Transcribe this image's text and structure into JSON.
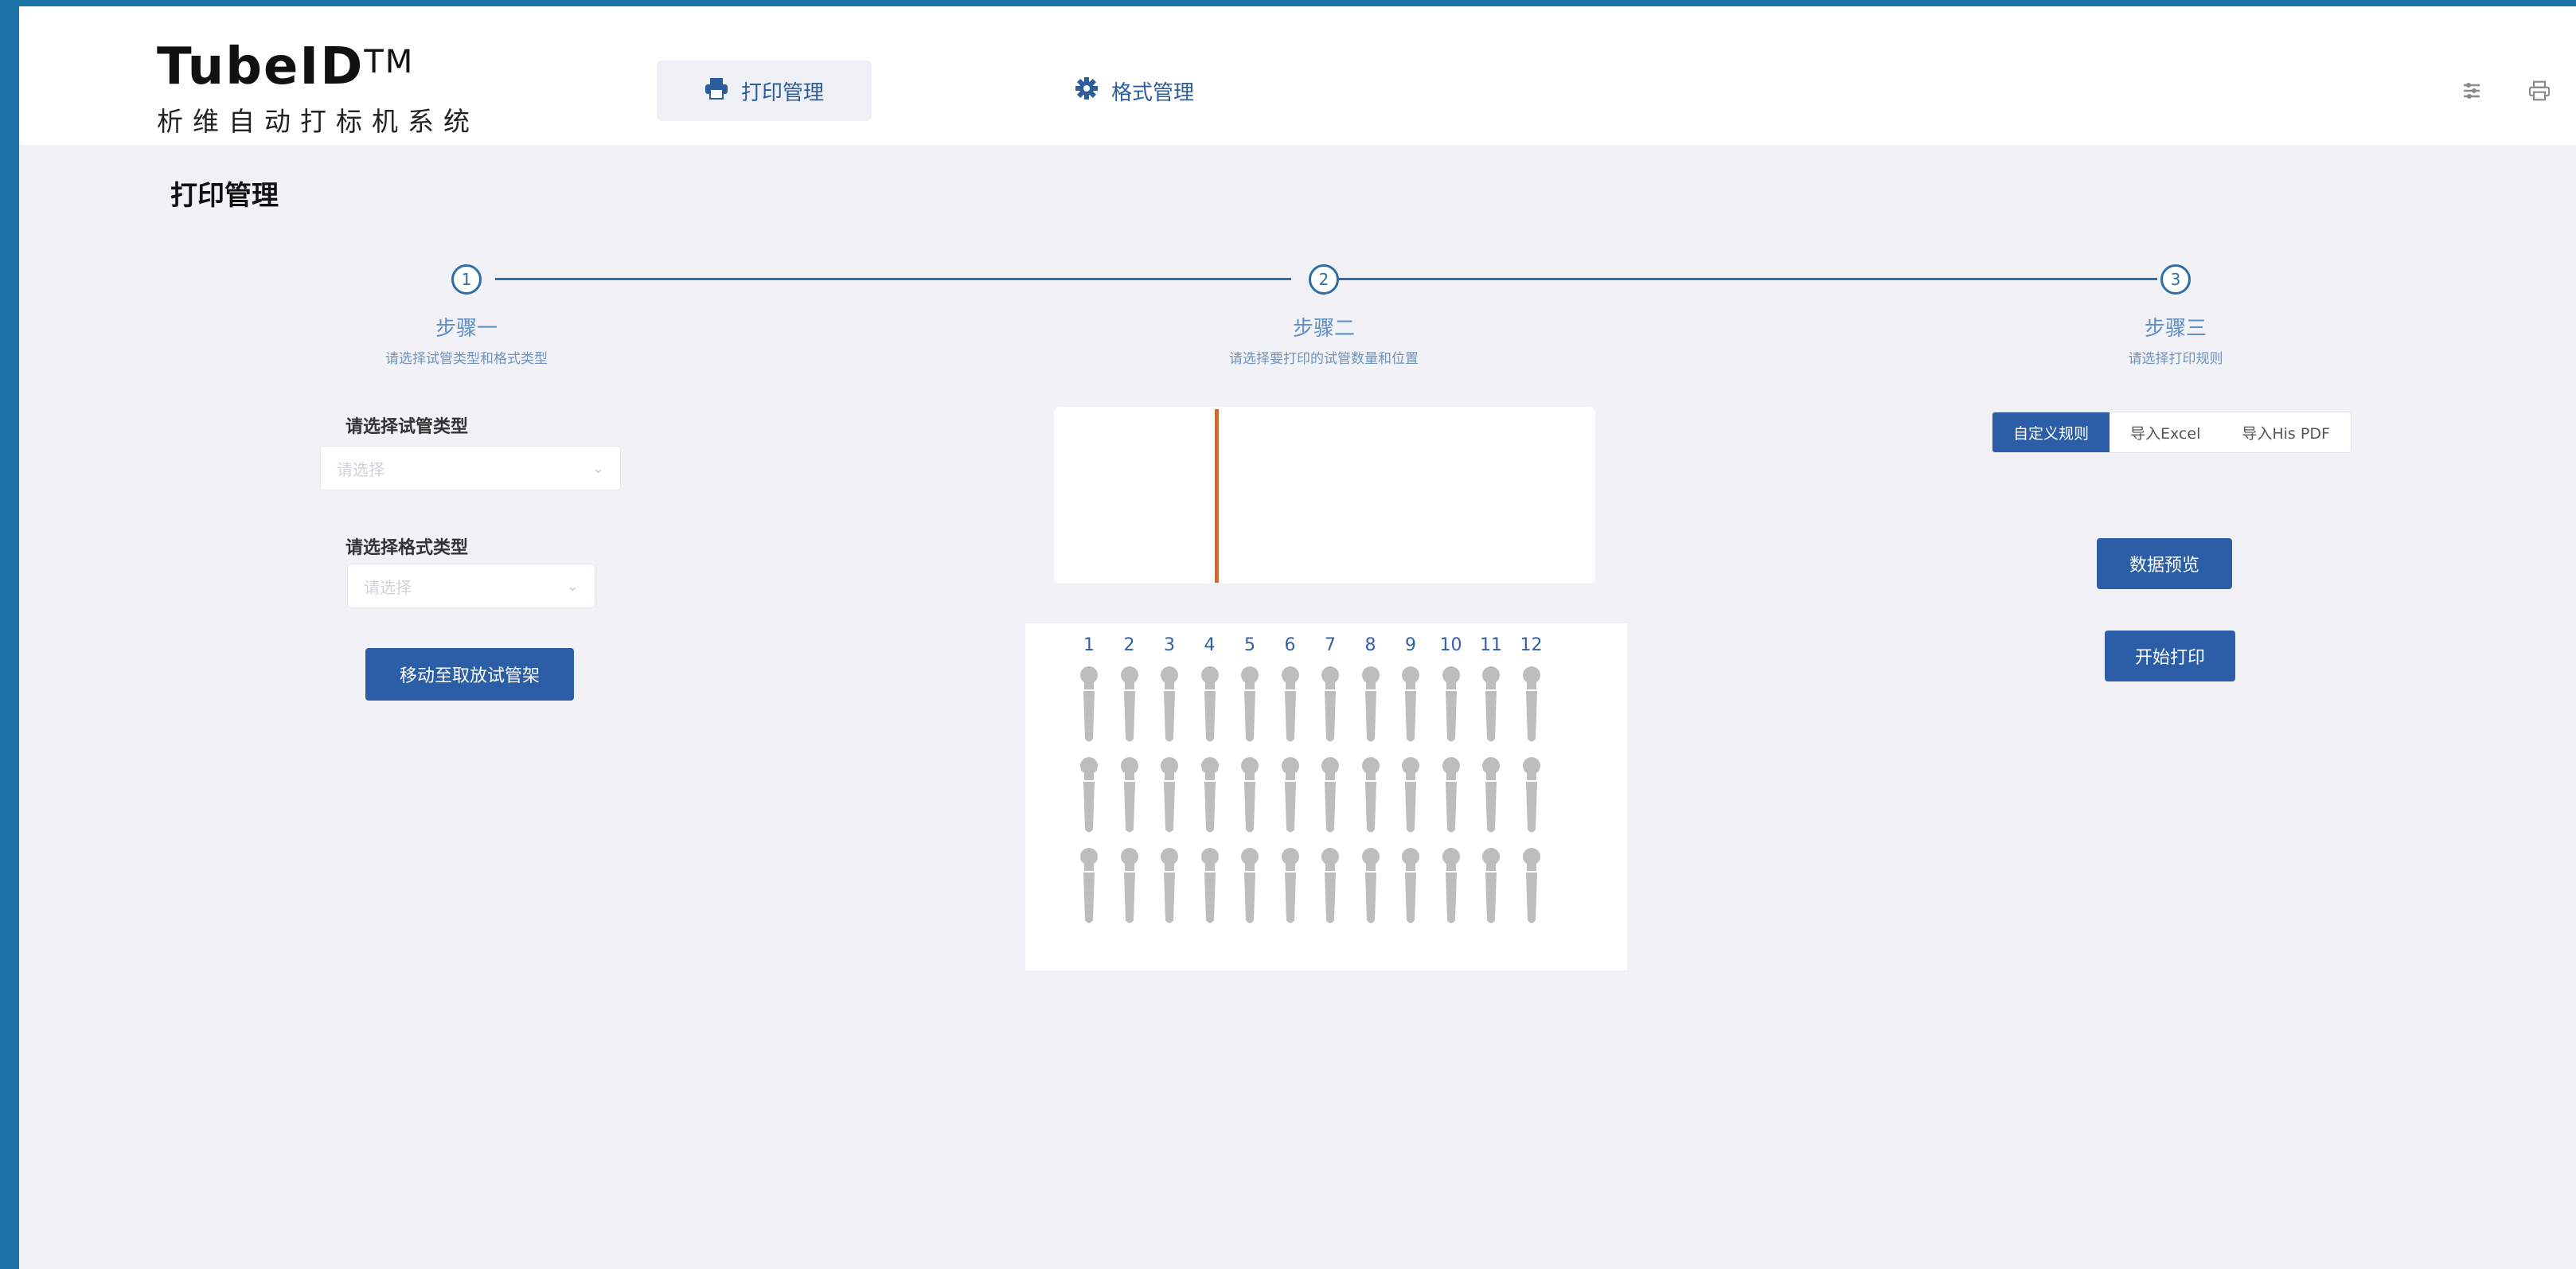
{
  "app": {
    "logo_main": "TubeID",
    "logo_tm": "TM",
    "logo_subtitle": "析维自动打标机系统"
  },
  "nav": {
    "print_label": "打印管理",
    "format_label": "格式管理"
  },
  "page": {
    "title": "打印管理"
  },
  "steps": [
    {
      "num": "1",
      "title": "步骤一",
      "desc": "请选择试管类型和格式类型"
    },
    {
      "num": "2",
      "title": "步骤二",
      "desc": "请选择要打印的试管数量和位置"
    },
    {
      "num": "3",
      "title": "步骤三",
      "desc": "请选择打印规则"
    }
  ],
  "step1": {
    "tube_type_label": "请选择试管类型",
    "tube_type_placeholder": "请选择",
    "format_type_label": "请选择格式类型",
    "format_type_placeholder": "请选择",
    "move_button": "移动至取放试管架"
  },
  "step2": {
    "columns": [
      "1",
      "2",
      "3",
      "4",
      "5",
      "6",
      "7",
      "8",
      "9",
      "10",
      "11",
      "12"
    ],
    "rows": 3,
    "tube_color": "#bdbdbd"
  },
  "step3": {
    "tabs": [
      "自定义规则",
      "导入Excel",
      "导入His PDF"
    ],
    "active_tab": 0,
    "preview_button": "数据预览",
    "print_button": "开始打印"
  },
  "colors": {
    "frame": "#1a72a6",
    "primary": "#2b5ea7",
    "step_line": "#2f6da7",
    "cursor": "#c86a3a",
    "background": "#f1f1f6"
  },
  "icons": {
    "print_nav": "printer-icon",
    "format_nav": "gear-icon",
    "header_right_1": "settings-sliders-icon",
    "header_right_2": "printer-icon"
  }
}
